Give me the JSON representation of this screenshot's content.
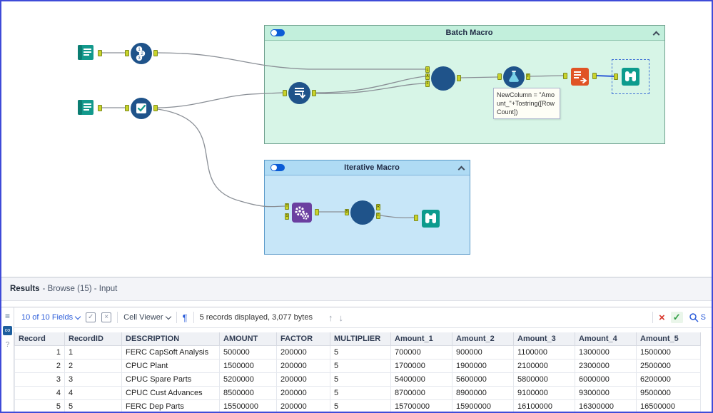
{
  "canvas": {
    "batch_container": {
      "title": "Batch Macro"
    },
    "iterative_container": {
      "title": "Iterative Macro"
    },
    "annotation_text": "NewColumn = \"Amount_\"+Tostring([RowCount])",
    "recordid_digits": {
      "d1": "1",
      "d2": "2",
      "d3": "3"
    },
    "anchor_letters": {
      "batch_in_top": "¿",
      "batch_in_mid": "A",
      "batch_in_low": "F",
      "formula_out": "F",
      "iter_tool_in_top": "T",
      "iter_tool_in_low": "S",
      "iter_circle_in": "B",
      "iter_circle_out_top": "R",
      "iter_circle_out_low": "F"
    }
  },
  "results": {
    "title": "Results",
    "breadcrumb": "- Browse (15) - Input",
    "side_rail": {
      "menu": "≡",
      "badge": "co",
      "help": "?"
    },
    "toolbar": {
      "fields": "10 of 10 Fields",
      "select_all_glyph": "✓",
      "deselect_glyph": "×",
      "cell_viewer": "Cell Viewer",
      "paragraph_glyph": "¶",
      "records_info": "5 records displayed, 3,077 bytes",
      "up_glyph": "↑",
      "down_glyph": "↓",
      "close_glyph": "×",
      "check_glyph": "✓",
      "search_letter": "S"
    },
    "table": {
      "columns": [
        "Record",
        "RecordID",
        "DESCRIPTION",
        "AMOUNT",
        "FACTOR",
        "MULTIPLIER",
        "Amount_1",
        "Amount_2",
        "Amount_3",
        "Amount_4",
        "Amount_5"
      ],
      "rows": [
        [
          "1",
          "1",
          "FERC CapSoft Analysis",
          "500000",
          "200000",
          "5",
          "700000",
          "900000",
          "1100000",
          "1300000",
          "1500000"
        ],
        [
          "2",
          "2",
          "CPUC Plant",
          "1500000",
          "200000",
          "5",
          "1700000",
          "1900000",
          "2100000",
          "2300000",
          "2500000"
        ],
        [
          "3",
          "3",
          "CPUC Spare Parts",
          "5200000",
          "200000",
          "5",
          "5400000",
          "5600000",
          "5800000",
          "6000000",
          "6200000"
        ],
        [
          "4",
          "4",
          "CPUC Cust Advances",
          "8500000",
          "200000",
          "5",
          "8700000",
          "8900000",
          "9100000",
          "9300000",
          "9500000"
        ],
        [
          "5",
          "5",
          "FERC Dep Parts",
          "15500000",
          "200000",
          "5",
          "15700000",
          "15900000",
          "16100000",
          "16300000",
          "16500000"
        ]
      ]
    }
  }
}
